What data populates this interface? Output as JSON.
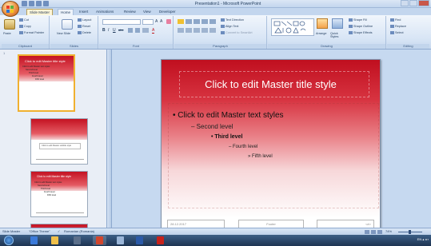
{
  "window": {
    "title": "Presentation1 - Microsoft PowerPoint"
  },
  "tabs": [
    {
      "label": "Slide Master"
    },
    {
      "label": "Home"
    },
    {
      "label": "Insert"
    },
    {
      "label": "Animations"
    },
    {
      "label": "Review"
    },
    {
      "label": "View"
    },
    {
      "label": "Developer"
    }
  ],
  "ribbon": {
    "clipboard": {
      "label": "Clipboard",
      "paste": "Paste",
      "cut": "Cut",
      "copy": "Copy",
      "format_painter": "Format Painter"
    },
    "slides": {
      "label": "Slides",
      "new_slide": "New Slide",
      "layout": "Layout",
      "reset": "Reset",
      "delete": "Delete"
    },
    "font": {
      "label": "Font"
    },
    "paragraph": {
      "label": "Paragraph",
      "text_direction": "Text Direction",
      "align_text": "Align Text",
      "convert_smartart": "Convert to SmartArt"
    },
    "drawing": {
      "label": "Drawing",
      "arrange": "Arrange",
      "quick_styles": "Quick Styles",
      "shape_fill": "Shape Fill",
      "shape_outline": "Shape Outline",
      "shape_effects": "Shape Effects"
    },
    "editing": {
      "label": "Editing",
      "find": "Find",
      "replace": "Replace",
      "select": "Select"
    }
  },
  "thumbnails": {
    "master": {
      "title": "Click to edit Master title style",
      "body": [
        "Click to edit Master text styles",
        "Second level",
        "Third level",
        "Fourth level",
        "Fifth level"
      ]
    },
    "layout2": {
      "subtitle": "Click to edit Master subtitle style"
    },
    "layout3": {
      "title": "Click to edit Master title style",
      "body": [
        "Click to edit Master text styles",
        "Second level",
        "Third level",
        "Fourth level",
        "Fifth level"
      ]
    }
  },
  "slide": {
    "title": "Click to edit Master title style",
    "level1": "Click to edit Master text styles",
    "level2": "– Second level",
    "level3": "• Third level",
    "level4": "– Fourth level",
    "level5": "» Fifth level",
    "date": "28.12.2017",
    "footer": "Footer",
    "number": "<#>"
  },
  "status": {
    "view": "Slide Master",
    "theme": "\"Office Theme\"",
    "language": "Romanian (Romania)",
    "zoom": "74%"
  },
  "tray": {
    "text": "EN"
  },
  "colors": {
    "slide_red": "#c00f1f",
    "ribbon_blue": "#c6d9f0"
  }
}
